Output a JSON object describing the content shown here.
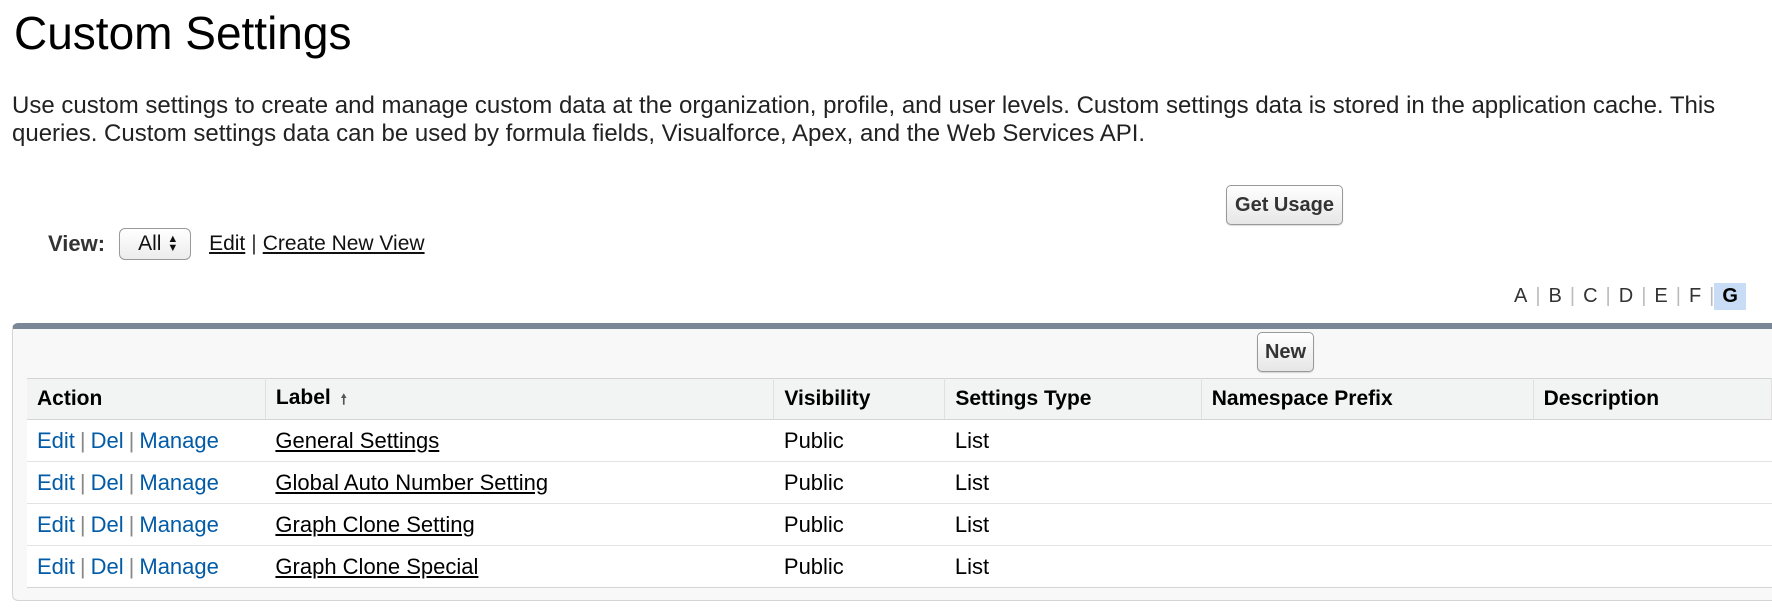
{
  "page": {
    "title": "Custom Settings",
    "description_line1": "Use custom settings to create and manage custom data at the organization, profile, and user levels. Custom settings data is stored in the application cache. This",
    "description_line2": "queries. Custom settings data can be used by formula fields, Visualforce, Apex, and the Web Services API."
  },
  "buttons": {
    "get_usage": "Get Usage",
    "new": "New"
  },
  "view": {
    "label": "View:",
    "selected": "All",
    "edit_link": "Edit",
    "separator": "|",
    "create_link": "Create New View"
  },
  "alphabet": {
    "letters": [
      "A",
      "B",
      "C",
      "D",
      "E",
      "F",
      "G"
    ],
    "active": "G"
  },
  "table": {
    "columns": [
      "Action",
      "Label",
      "Visibility",
      "Settings Type",
      "Namespace Prefix",
      "Description"
    ],
    "action_labels": {
      "edit": "Edit",
      "del": "Del",
      "manage": "Manage",
      "sep": "|"
    },
    "rows": [
      {
        "label": "General Settings",
        "visibility": "Public",
        "type": "List",
        "namespace": "",
        "description": ""
      },
      {
        "label": "Global Auto Number Setting",
        "visibility": "Public",
        "type": "List",
        "namespace": "",
        "description": ""
      },
      {
        "label": "Graph Clone Setting",
        "visibility": "Public",
        "type": "List",
        "namespace": "",
        "description": ""
      },
      {
        "label": "Graph Clone Special",
        "visibility": "Public",
        "type": "List",
        "namespace": "",
        "description": ""
      }
    ]
  },
  "colors": {
    "link_blue": "#015ba7",
    "panel_top_border": "#7a8796",
    "active_letter_bg": "#c8dcf5"
  },
  "icons": {
    "sort": "sort-ascending-icon",
    "select": "select-arrows-icon"
  }
}
